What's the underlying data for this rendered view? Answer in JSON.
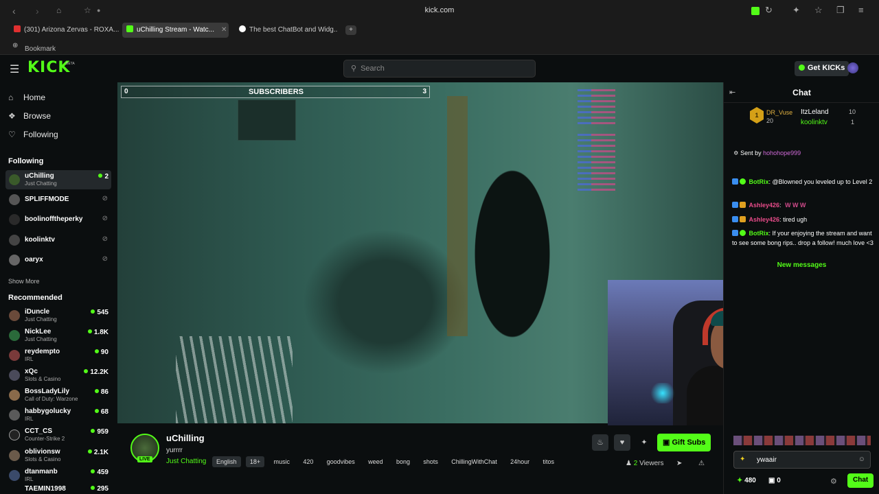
{
  "browser": {
    "url": "kick.com",
    "tabs": [
      {
        "label": "(301) Arizona Zervas - ROXA...",
        "fav": "#e03030"
      },
      {
        "label": "uChilling Stream - Watc...",
        "fav": "#53fc18"
      },
      {
        "label": "The best ChatBot and Widg...",
        "fav": "#ffffff"
      }
    ],
    "bookmark": "Bookmark"
  },
  "header": {
    "logo": "KICK",
    "beta": "BETA",
    "search_placeholder": "Search",
    "get_kicks": "Get KICKs"
  },
  "sidebar": {
    "nav": [
      {
        "label": "Home",
        "icon": "home-icon"
      },
      {
        "label": "Browse",
        "icon": "compass-icon"
      },
      {
        "label": "Following",
        "icon": "heart-icon"
      }
    ],
    "following_title": "Following",
    "following": [
      {
        "name": "uChilling",
        "category": "Just Chatting",
        "viewers": "2",
        "live": true
      },
      {
        "name": "SPLIFFMODE",
        "category": "",
        "viewers": "",
        "live": false
      },
      {
        "name": "boolinofftheperky",
        "category": "",
        "viewers": "",
        "live": false
      },
      {
        "name": "koolinktv",
        "category": "",
        "viewers": "",
        "live": false
      },
      {
        "name": "oaryx",
        "category": "",
        "viewers": "",
        "live": false
      }
    ],
    "show_more": "Show More",
    "recommended_title": "Recommended",
    "recommended": [
      {
        "name": "iDuncle",
        "category": "Just Chatting",
        "viewers": "545"
      },
      {
        "name": "NickLee",
        "category": "Just Chatting",
        "viewers": "1.8K"
      },
      {
        "name": "reydempto",
        "category": "IRL",
        "viewers": "90"
      },
      {
        "name": "xQc",
        "category": "Slots & Casino",
        "viewers": "12.2K"
      },
      {
        "name": "BossLadyLily",
        "category": "Call of Duty: Warzone",
        "viewers": "86"
      },
      {
        "name": "habbygolucky",
        "category": "IRL",
        "viewers": "68"
      },
      {
        "name": "CCT_CS",
        "category": "Counter-Strike 2",
        "viewers": "959"
      },
      {
        "name": "oblivionsw",
        "category": "Slots & Casino",
        "viewers": "2.1K"
      },
      {
        "name": "dtanmanb",
        "category": "IRL",
        "viewers": "459"
      },
      {
        "name": "TAEMIN1998",
        "category": "",
        "viewers": "295"
      }
    ]
  },
  "video": {
    "subs_left": "0",
    "subs_label": "SUBSCRIBERS",
    "subs_right": "3"
  },
  "stream": {
    "channel": "uChilling",
    "title": "yurrrr",
    "category": "Just Chatting",
    "live_badge": "LIVE",
    "tags": [
      "English",
      "18+",
      "music",
      "420",
      "goodvibes",
      "weed",
      "bong",
      "shots",
      "ChillingWithChat",
      "24hour",
      "titos"
    ],
    "viewers_count": "2",
    "viewers_label": "Viewers",
    "gift_subs": "Gift Subs"
  },
  "chat": {
    "title": "Chat",
    "leaderboard": [
      {
        "user": "DR_Vuse",
        "value": "20",
        "rank": "1"
      },
      {
        "user": "ItzLeland",
        "value": "10"
      },
      {
        "user": "koolinktv",
        "value": "1"
      }
    ],
    "pinned_prefix": "Sent by",
    "pinned_user": "hohohope999",
    "messages": [
      {
        "user": "BotRix",
        "kind": "bot",
        "text": "@Blowned you leveled up to Level 2"
      },
      {
        "user": "Ashley426",
        "kind": "user",
        "text": "",
        "emotes": "W W W"
      },
      {
        "user": "Ashley426",
        "kind": "user",
        "text": "tired ugh",
        "emotes": ""
      },
      {
        "user": "BotRix",
        "kind": "bot",
        "text": "If your enjoying the stream and want to see some bong rips.. drop a follow! much love <3"
      }
    ],
    "new_messages": "New messages",
    "input_value": "ywaair",
    "points": "480",
    "kicks": "0",
    "send_label": "Chat"
  },
  "colors": {
    "brand": "#53fc18",
    "bg": "#0b0e0f",
    "panel": "#1e2224"
  }
}
